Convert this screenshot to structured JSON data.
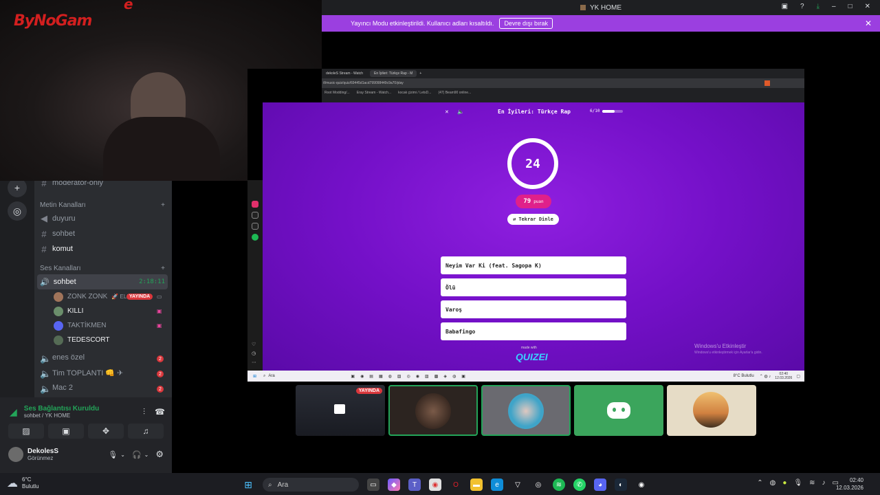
{
  "window": {
    "title": "YK HOME"
  },
  "banner": {
    "text": "Yayıncı Modu etkinleştirildi. Kullanıcı adları kısaltıldı.",
    "button": "Devre dışı bırak"
  },
  "webcam": {
    "logo": "ByNoGam",
    "logo_letter": "e"
  },
  "sidebar": {
    "moderator_channel": "moderatör-only",
    "text_category": "Metin Kanalları",
    "text_channels": [
      "duyuru",
      "sohbet",
      "komut"
    ],
    "voice_category": "Ses Kanalları",
    "active_voice": {
      "name": "sohbet",
      "timer": "2:18:11"
    },
    "voice_users": [
      {
        "name": "ZONK ZONK",
        "extra": "🚀 ELI",
        "live": "YAYINDA"
      },
      {
        "name": "KILLI"
      },
      {
        "name": "TAKTİKMEN"
      },
      {
        "name": "TEDESCORT"
      }
    ],
    "other_voice": [
      {
        "name": "enes özel",
        "badge": "2"
      },
      {
        "name": "Tim TOPLANTI 👊 ✈",
        "badge": "2"
      },
      {
        "name": "Mac 2",
        "badge": "2"
      }
    ]
  },
  "voice_status": {
    "title": "Ses Bağlantısı Kuruldu",
    "subtitle": "sohbet / YK HOME"
  },
  "user": {
    "name": "DekolesS",
    "status": "Görünmez"
  },
  "browser": {
    "tabs": [
      "dekoleS Stream - Watch",
      "En İyileri: Türkçe Rap - M"
    ],
    "url": "/t/music-quiz/quiz/69445d1acd799098449c9a70/play",
    "bookmarks": [
      "Root Modding/...",
      "Eray Stream - Watch...",
      "kocak çizimi / LetsD...",
      "(47) Beam90 online..."
    ]
  },
  "quiz": {
    "title": "En İyileri: Türkçe Rap",
    "progress": "6/10",
    "progress_fraction": 0.6,
    "timer": "24",
    "points_value": "79",
    "points_label": "puan",
    "replay": "Tekrar Dinle",
    "answers": [
      "Neyim Var Ki (feat. Sagopa K)",
      "Ölü",
      "Varoş",
      "Babafingo"
    ],
    "made_with": "made with",
    "brand": "QUIZEI",
    "watermark_title": "Windows'u Etkinleştir",
    "watermark_sub": "Windows'u etkinleştirmek için Ayarlar'a gidin."
  },
  "inner_taskbar": {
    "search": "Ara",
    "weather": "8°C Bulutlu",
    "time": "02:40",
    "date": "12.03.2026"
  },
  "tiles": {
    "live_label": "YAYINDA"
  },
  "taskbar": {
    "weather_temp": "6°C",
    "weather_desc": "Bulutlu",
    "search": "Ara",
    "time": "02:40",
    "date": "12.03.2026"
  }
}
